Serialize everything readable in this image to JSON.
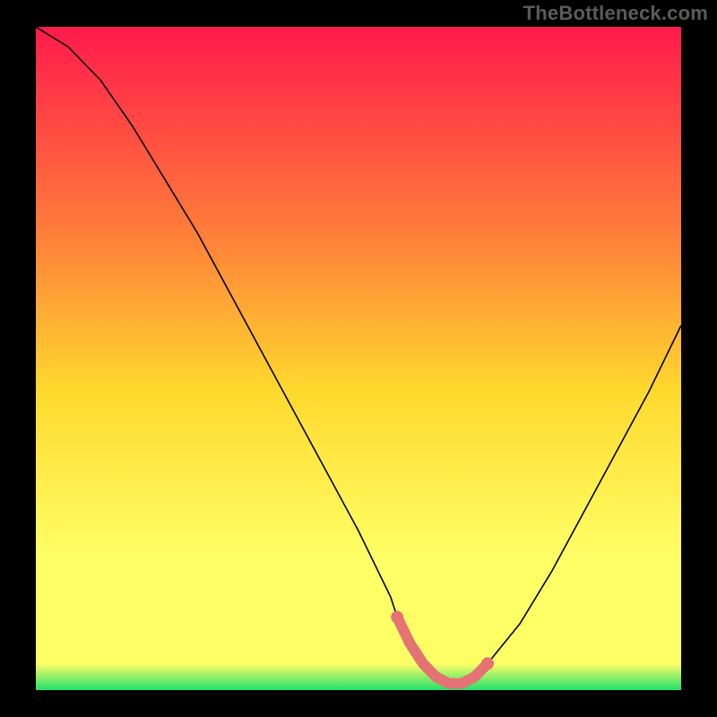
{
  "watermark": "TheBottleneck.com",
  "colors": {
    "frame": "#000000",
    "gradient_top": "#ff1a4b",
    "gradient_mid1": "#ff7a3a",
    "gradient_mid2": "#ffd92e",
    "gradient_mid3": "#ffff66",
    "gradient_bottom": "#21e06a",
    "curve": "#000000",
    "marker": "#e57373"
  },
  "chart_data": {
    "type": "line",
    "title": "",
    "xlabel": "",
    "ylabel": "",
    "x": [
      0,
      5,
      10,
      15,
      20,
      25,
      30,
      35,
      40,
      45,
      50,
      55,
      56,
      58,
      60,
      62,
      64,
      66,
      68,
      70,
      75,
      80,
      85,
      90,
      95,
      100
    ],
    "values": [
      100,
      97,
      92,
      85,
      77,
      69,
      60,
      51,
      42,
      33,
      24,
      14,
      11,
      7,
      4,
      2,
      1,
      1,
      2,
      4,
      10,
      18,
      27,
      36,
      45,
      55
    ],
    "xlim": [
      0,
      100
    ],
    "ylim": [
      0,
      100
    ],
    "markers": {
      "x": [
        56,
        58,
        60,
        62,
        64,
        66,
        68,
        70
      ],
      "y": [
        11,
        7,
        4,
        2,
        1,
        1,
        2,
        4
      ]
    }
  }
}
